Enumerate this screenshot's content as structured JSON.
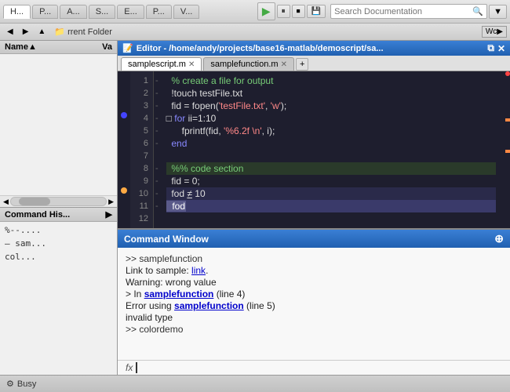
{
  "toolbar": {
    "search_placeholder": "Search Documentation",
    "tabs": [
      "H...",
      "P...",
      "A...",
      "S...",
      "E...",
      "P...",
      "V..."
    ],
    "play_icon": "▶",
    "filter_icon": "▼"
  },
  "second_toolbar": {
    "folder_label": "rrent Folder",
    "word_wrap": "Wc▶"
  },
  "file_browser": {
    "title": "Name",
    "col_name": "Name",
    "col_val": "Va",
    "sort_icon": "▲"
  },
  "cmd_history": {
    "title": "Command His...",
    "items": [
      "%--...",
      "sam...",
      "col..."
    ]
  },
  "editor": {
    "title": "Editor - /home/andy/projects/base16-matlab/demoscript/sa...",
    "tabs": [
      {
        "label": "samplescript.m",
        "active": true
      },
      {
        "label": "samplefunction.m",
        "active": false
      }
    ],
    "add_tab": "+",
    "lines": [
      {
        "num": 1,
        "text": "  % create a file for output",
        "type": "comment"
      },
      {
        "num": 2,
        "text": "  !touch testFile.txt",
        "type": "normal"
      },
      {
        "num": 3,
        "text": "  fid = fopen('testFile.txt', 'w');",
        "type": "normal"
      },
      {
        "num": 4,
        "text": "□ for ii=1:10",
        "type": "keyword"
      },
      {
        "num": 5,
        "text": "      fprintf(fid, '%6.2f \\n', i);",
        "type": "normal"
      },
      {
        "num": 6,
        "text": "  end",
        "type": "normal"
      },
      {
        "num": 7,
        "text": "",
        "type": "normal"
      },
      {
        "num": 8,
        "text": "  %% code section",
        "type": "section"
      },
      {
        "num": 9,
        "text": "  fid = 0;",
        "type": "normal"
      },
      {
        "num": 10,
        "text": "  fod = 10",
        "type": "highlight"
      },
      {
        "num": 11,
        "text": "  fod",
        "type": "selected"
      },
      {
        "num": 12,
        "text": "",
        "type": "normal"
      }
    ]
  },
  "command_window": {
    "title": "Command Window",
    "expand_icon": "⊕",
    "output": [
      {
        "type": "prompt",
        "text": ">> samplefunction"
      },
      {
        "type": "normal",
        "text": "Link to sample: "
      },
      {
        "type": "link",
        "link_text": "link"
      },
      {
        "type": "normal_line",
        "text": "Warning: wrong value"
      },
      {
        "type": "error",
        "text": "> In "
      },
      {
        "type": "bold_link",
        "text": "samplefunction"
      },
      {
        "type": "error_suffix",
        "text": " (line 4)"
      },
      {
        "type": "error",
        "text": "Error using "
      },
      {
        "type": "bold_link2",
        "text": "samplefunction"
      },
      {
        "type": "error_suffix2",
        "text": " (line 5)"
      },
      {
        "type": "normal_line",
        "text": "invalid type"
      },
      {
        "type": "prompt",
        "text": ">> colordemo"
      }
    ],
    "fx_label": "fx"
  },
  "status_bar": {
    "text": "Busy"
  }
}
